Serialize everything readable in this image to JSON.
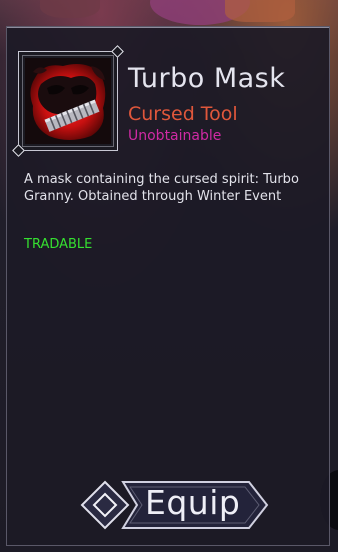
{
  "item": {
    "name": "Turbo Mask",
    "type": "Cursed Tool",
    "availability": "Unobtainable",
    "description": "A mask containing the cursed spirit: Turbo Granny. Obtained through Winter Event",
    "trade_status": "TRADABLE",
    "icon": "turbo-mask-icon"
  },
  "actions": {
    "equip_label": "Equip",
    "equip_icon": "diamond-icon"
  },
  "colors": {
    "type": "#e0573b",
    "availability": "#d02aa4",
    "trade_status": "#35e030",
    "item_glow": "#e01818"
  }
}
